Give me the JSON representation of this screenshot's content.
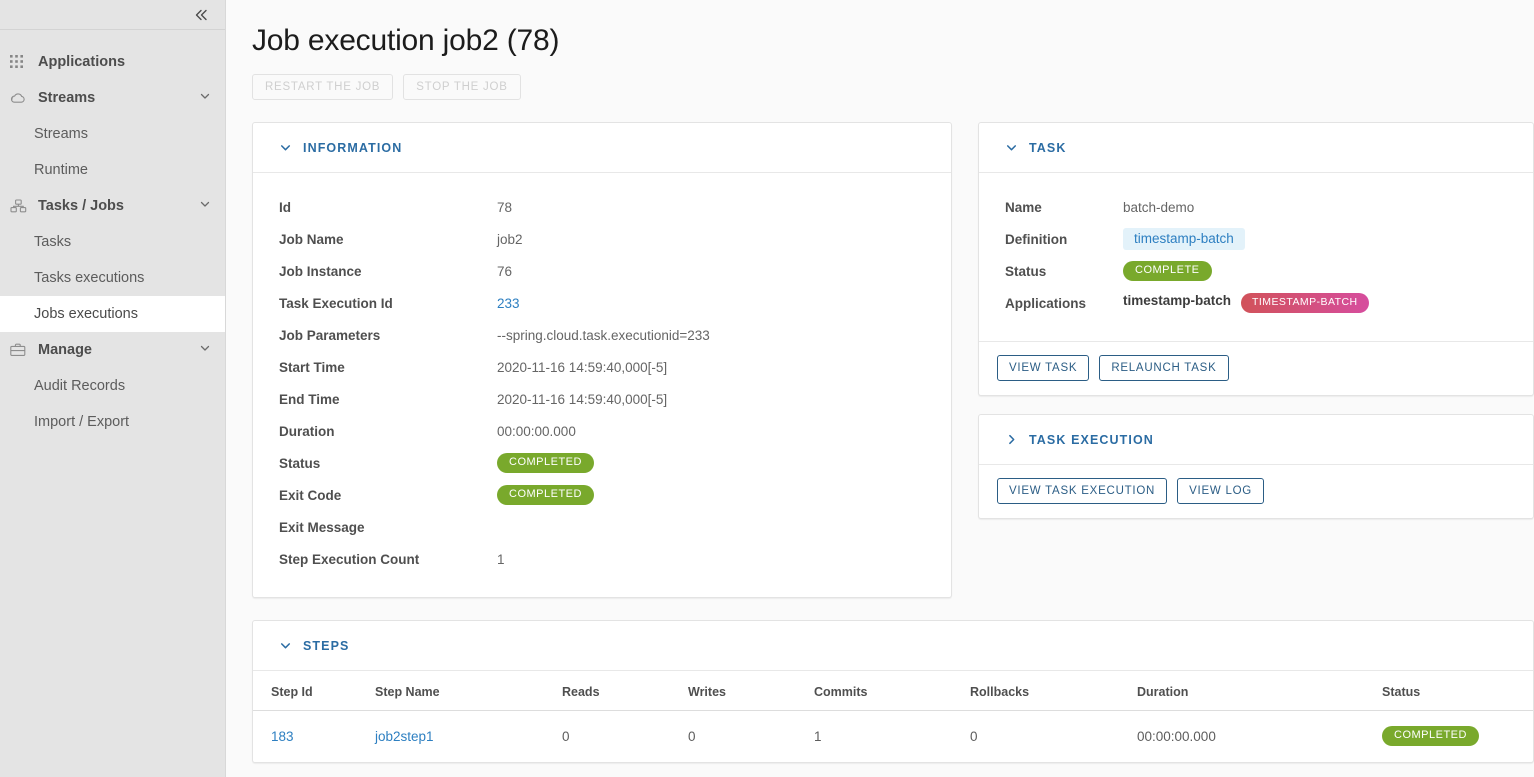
{
  "sidebar": {
    "collapse_icon": "double-chevron-left-icon",
    "groups": [
      {
        "label": "Applications",
        "icon": "grid-icon",
        "expandable": false,
        "items": []
      },
      {
        "label": "Streams",
        "icon": "cloud-icon",
        "expandable": true,
        "chevron": "chevron-down-icon",
        "items": [
          {
            "label": "Streams",
            "active": false
          },
          {
            "label": "Runtime",
            "active": false
          }
        ]
      },
      {
        "label": "Tasks / Jobs",
        "icon": "tasks-icon",
        "expandable": true,
        "chevron": "chevron-down-icon",
        "items": [
          {
            "label": "Tasks",
            "active": false
          },
          {
            "label": "Tasks executions",
            "active": false
          },
          {
            "label": "Jobs executions",
            "active": true
          }
        ]
      },
      {
        "label": "Manage",
        "icon": "briefcase-icon",
        "expandable": true,
        "chevron": "chevron-down-icon",
        "items": [
          {
            "label": "Audit Records",
            "active": false
          },
          {
            "label": "Import / Export",
            "active": false
          }
        ]
      }
    ]
  },
  "page": {
    "title": "Job execution job2 (78)",
    "actions": [
      {
        "label": "RESTART THE JOB",
        "disabled": true
      },
      {
        "label": "STOP THE JOB",
        "disabled": true
      }
    ]
  },
  "information": {
    "heading": "INFORMATION",
    "caret": "chevron-down-icon",
    "rows": [
      {
        "key": "Id",
        "value": "78",
        "type": "text"
      },
      {
        "key": "Job Name",
        "value": "job2",
        "type": "text"
      },
      {
        "key": "Job Instance",
        "value": "76",
        "type": "text"
      },
      {
        "key": "Task Execution Id",
        "value": "233",
        "type": "link"
      },
      {
        "key": "Job Parameters",
        "value": "--spring.cloud.task.executionid=233",
        "type": "text"
      },
      {
        "key": "Start Time",
        "value": "2020-11-16 14:59:40,000[-5]",
        "type": "text"
      },
      {
        "key": "End Time",
        "value": "2020-11-16 14:59:40,000[-5]",
        "type": "text"
      },
      {
        "key": "Duration",
        "value": "00:00:00.000",
        "type": "text"
      },
      {
        "key": "Status",
        "value": "COMPLETED",
        "type": "badge-green"
      },
      {
        "key": "Exit Code",
        "value": "COMPLETED",
        "type": "badge-green"
      },
      {
        "key": "Exit Message",
        "value": "",
        "type": "text"
      },
      {
        "key": "Step Execution Count",
        "value": "1",
        "type": "text"
      }
    ]
  },
  "task": {
    "heading": "TASK",
    "caret": "chevron-down-icon",
    "name_label": "Name",
    "name_value": "batch-demo",
    "definition_label": "Definition",
    "definition_value": "timestamp-batch",
    "status_label": "Status",
    "status_value": "COMPLETE",
    "applications_label": "Applications",
    "applications_value": "timestamp-batch",
    "applications_badge": "TIMESTAMP-BATCH",
    "buttons": [
      {
        "label": "VIEW TASK"
      },
      {
        "label": "RELAUNCH TASK"
      }
    ]
  },
  "task_execution": {
    "heading": "TASK EXECUTION",
    "caret": "chevron-right-icon",
    "buttons": [
      {
        "label": "VIEW TASK EXECUTION"
      },
      {
        "label": "VIEW LOG"
      }
    ]
  },
  "steps": {
    "heading": "STEPS",
    "caret": "chevron-down-icon",
    "columns": [
      "Step Id",
      "Step Name",
      "Reads",
      "Writes",
      "Commits",
      "Rollbacks",
      "Duration",
      "Status"
    ],
    "rows": [
      {
        "step_id": "183",
        "step_name": "job2step1",
        "reads": "0",
        "writes": "0",
        "commits": "1",
        "rollbacks": "0",
        "duration": "00:00:00.000",
        "status": "COMPLETED"
      }
    ]
  },
  "colors": {
    "accent_blue": "#2b6ca3",
    "link_blue": "#2d7fc1",
    "status_green": "#79a92c",
    "badge_grad_from": "#d1525a",
    "badge_grad_to": "#d64d9e",
    "chip_blue_bg": "#e3f2fa",
    "sidebar_bg": "#e4e4e4",
    "page_bg": "#fafafa"
  }
}
